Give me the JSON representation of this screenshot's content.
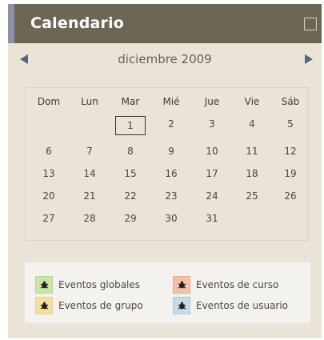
{
  "calendar": {
    "title": "Calendario",
    "month_label": "diciembre 2009",
    "weekdays": [
      "Dom",
      "Lun",
      "Mar",
      "Mié",
      "Jue",
      "Vie",
      "Sáb"
    ],
    "today": "1",
    "weeks": [
      [
        "",
        "",
        "1",
        "2",
        "3",
        "4",
        "5"
      ],
      [
        "6",
        "7",
        "8",
        "9",
        "10",
        "11",
        "12"
      ],
      [
        "13",
        "14",
        "15",
        "16",
        "17",
        "18",
        "19"
      ],
      [
        "20",
        "21",
        "22",
        "23",
        "24",
        "25",
        "26"
      ],
      [
        "27",
        "28",
        "29",
        "30",
        "31",
        "",
        ""
      ]
    ]
  },
  "legend": {
    "items": [
      {
        "label": "Eventos globales",
        "icon": "global-events-icon",
        "color": "#c9e6a6"
      },
      {
        "label": "Eventos de curso",
        "icon": "course-events-icon",
        "color": "#f2c1a6"
      },
      {
        "label": "Eventos de grupo",
        "icon": "group-events-icon",
        "color": "#f3e0a5"
      },
      {
        "label": "Eventos de usuario",
        "icon": "user-events-icon",
        "color": "#c9d9e8"
      }
    ]
  },
  "colors": {
    "header_bg": "#6e6654",
    "header_accent": "#8a93a3",
    "block_bg": "#eae4d6",
    "nav_arrow": "#55657a"
  }
}
